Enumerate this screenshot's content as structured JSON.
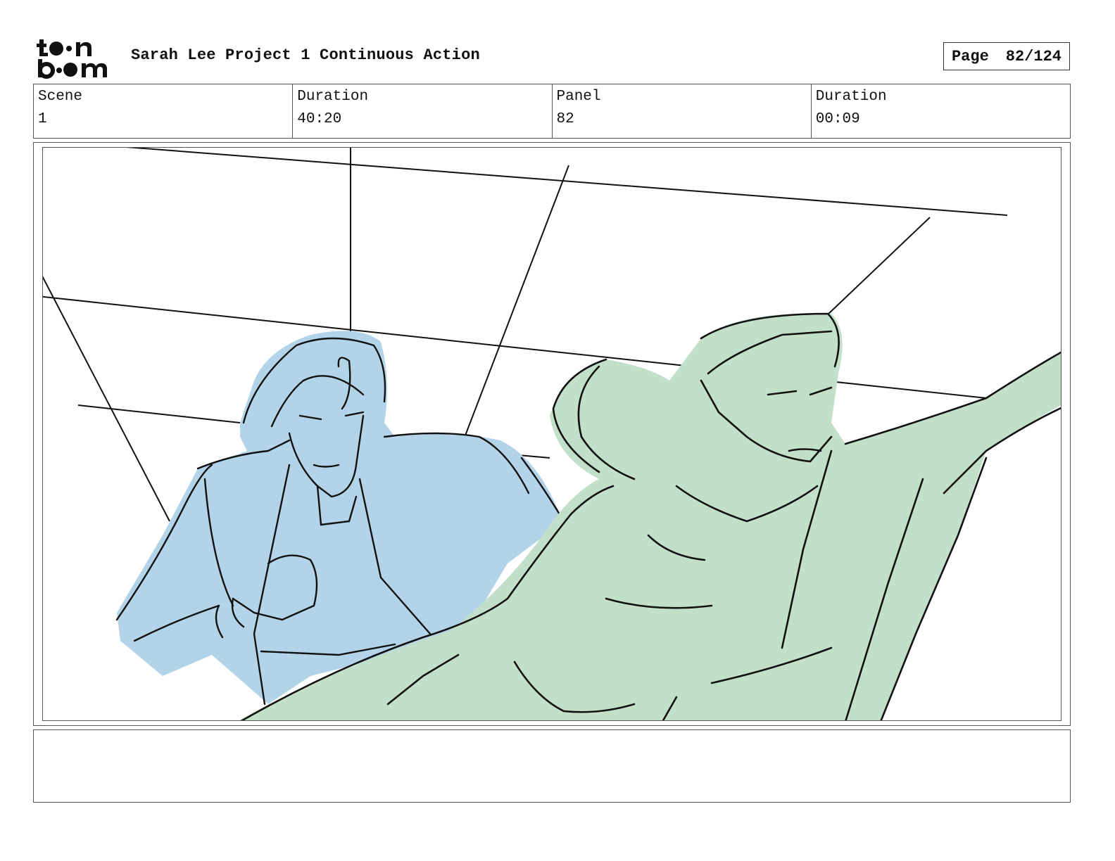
{
  "header": {
    "title": "Sarah Lee Project 1 Continuous Action",
    "page_label": "Page",
    "page_value": "82/124"
  },
  "logo": {
    "text": "toon boom"
  },
  "info": {
    "scene_label": "Scene",
    "scene_value": "1",
    "duration_label": "Duration",
    "duration_value": "40:20",
    "panel_label": "Panel",
    "panel_value": "82",
    "panel_duration_label": "Duration",
    "panel_duration_value": "00:09"
  },
  "colors": {
    "blue_fill": "#b3d4e8",
    "green_fill": "#c1dfc9",
    "line": "#111111"
  },
  "notes": {
    "text": ""
  }
}
